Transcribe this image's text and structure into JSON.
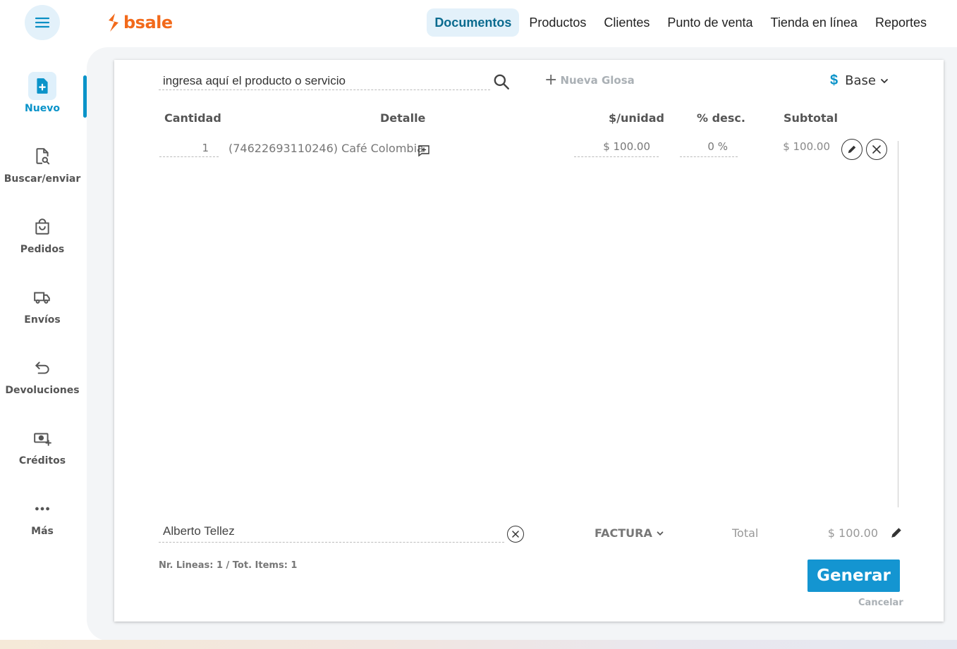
{
  "header": {
    "logo_text": "bsale",
    "nav": [
      {
        "label": "Documentos",
        "active": true
      },
      {
        "label": "Productos",
        "active": false
      },
      {
        "label": "Clientes",
        "active": false
      },
      {
        "label": "Punto de venta",
        "active": false
      },
      {
        "label": "Tienda en línea",
        "active": false
      },
      {
        "label": "Reportes",
        "active": false
      }
    ]
  },
  "sidebar": {
    "items": [
      {
        "label": "Nuevo",
        "icon": "new-document-icon",
        "active": true
      },
      {
        "label": "Buscar/enviar",
        "icon": "search-document-icon"
      },
      {
        "label": "Pedidos",
        "icon": "shopping-bag-icon"
      },
      {
        "label": "Envíos",
        "icon": "truck-icon"
      },
      {
        "label": "Devoluciones",
        "icon": "return-arrow-icon"
      },
      {
        "label": "Créditos",
        "icon": "money-plus-icon"
      },
      {
        "label": "Más",
        "icon": "more-dots-icon"
      }
    ]
  },
  "toolbar": {
    "search_placeholder": "ingresa aquí el producto o servicio",
    "nueva_glosa": "Nueva Glosa",
    "currency_symbol": "$",
    "price_list": "Base"
  },
  "table": {
    "headers": {
      "cantidad": "Cantidad",
      "detalle": "Detalle",
      "unidad": "$/unidad",
      "desc": "% desc.",
      "subtotal": "Subtotal"
    },
    "rows": [
      {
        "cantidad": "1",
        "detalle": "(74622693110246) Café Colombia",
        "precio": "$ 100.00",
        "descuento": "0 %",
        "subtotal": "$ 100.00"
      }
    ]
  },
  "footer": {
    "client": "Alberto Tellez",
    "document_type": "FACTURA",
    "total_label": "Total",
    "total_value": "$ 100.00",
    "summary": "Nr. Lineas: 1 / Tot. Items: 1",
    "generate_label": "Generar",
    "cancel_label": "Cancelar"
  },
  "colors": {
    "brand": "#f26a1b",
    "accent": "#1495d1",
    "active_nav_bg": "#e3f1fa"
  }
}
